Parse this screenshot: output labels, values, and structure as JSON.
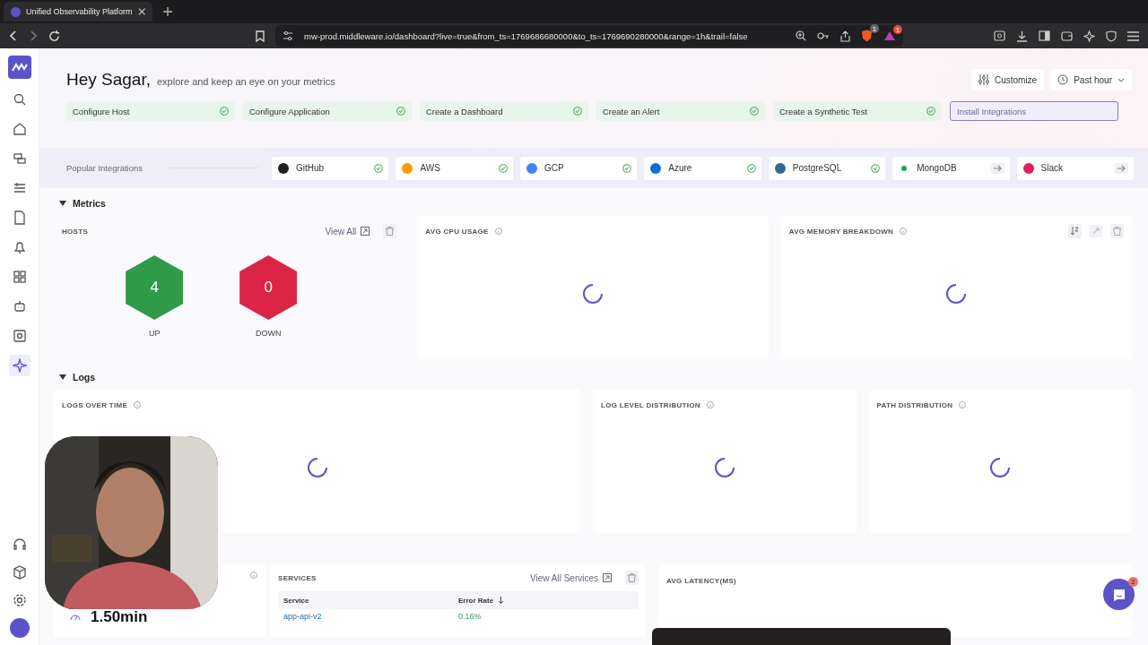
{
  "browser": {
    "tab_title": "Unified Observability Platform",
    "url": "mw-prod.middleware.io/dashboard?live=true&from_ts=1769686680000&to_ts=1769690280000&range=1h&trail=false",
    "badges": [
      "1",
      "1"
    ]
  },
  "sidebar": {
    "items": [
      {
        "selected": false
      },
      {
        "selected": false
      },
      {
        "selected": false
      },
      {
        "selected": false
      },
      {
        "selected": false
      },
      {
        "selected": false
      },
      {
        "selected": false
      },
      {
        "selected": false
      },
      {
        "selected": false
      },
      {
        "selected": true
      }
    ]
  },
  "greeting": {
    "title": "Hey Sagar,",
    "subtitle": "explore and keep an eye on your metrics"
  },
  "actions": {
    "customize": "Customize",
    "time_range": "Past hour"
  },
  "checklist": [
    {
      "label": "Configure Host",
      "done": true
    },
    {
      "label": "Configure Application",
      "done": true
    },
    {
      "label": "Create a Dashboard",
      "done": true
    },
    {
      "label": "Create an Alert",
      "done": true
    },
    {
      "label": "Create a Synthetic Test",
      "done": true
    },
    {
      "label": "Install Integrations",
      "done": false
    }
  ],
  "integrations": {
    "label": "Popular Integrations",
    "items": [
      {
        "name": "GitHub",
        "connected": true
      },
      {
        "name": "AWS",
        "connected": true
      },
      {
        "name": "GCP",
        "connected": true
      },
      {
        "name": "Azure",
        "connected": true
      },
      {
        "name": "PostgreSQL",
        "connected": true
      },
      {
        "name": "MongoDB",
        "connected": false
      },
      {
        "name": "Slack",
        "connected": false
      }
    ]
  },
  "metrics": {
    "title": "Metrics",
    "expanded": true,
    "hosts": {
      "title": "HOSTS",
      "view_all": "View All",
      "up": {
        "count": "4",
        "label": "UP"
      },
      "down": {
        "count": "0",
        "label": "DOWN"
      }
    },
    "cards": [
      {
        "title": "AVG CPU USAGE",
        "loading": true
      },
      {
        "title": "AVG MEMORY BREAKDOWN",
        "loading": true
      }
    ]
  },
  "logs": {
    "title": "Logs",
    "expanded": true,
    "cards": [
      {
        "title": "LOGS OVER TIME",
        "loading": true
      },
      {
        "title": "LOG LEVEL DISTRIBUTION",
        "loading": true
      },
      {
        "title": "PATH DISTRIBUTION",
        "loading": true
      }
    ]
  },
  "bottom": {
    "stat_value": "1.50min",
    "services": {
      "title": "SERVICES",
      "view_all": "View All Services",
      "columns": [
        "Service",
        "Error Rate"
      ],
      "rows": [
        {
          "service": "app-api-v2",
          "error_rate": "0.16%"
        }
      ]
    },
    "latency": {
      "title": "AVG LATENCY(MS)"
    }
  },
  "chat": {
    "badge": "2"
  }
}
